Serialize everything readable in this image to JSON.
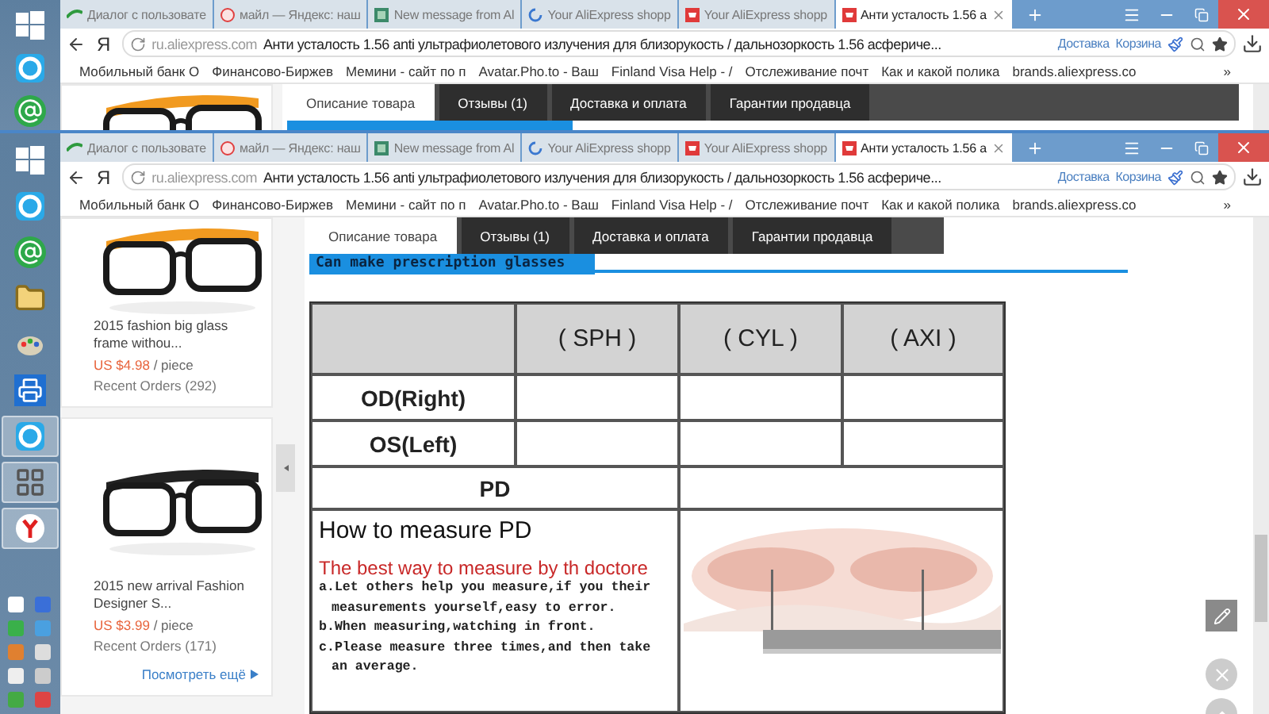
{
  "back_window": {
    "taskbar": [
      {
        "kind": "windows",
        "active": false
      },
      {
        "kind": "skype",
        "active": false
      },
      {
        "kind": "mail",
        "active": false
      }
    ],
    "tabs": [
      {
        "title": "Диалог с пользовате",
        "kind": "dialog",
        "selected": false
      },
      {
        "title": "майл — Яндекс: наш",
        "kind": "yandex",
        "selected": false
      },
      {
        "title": "New message from Al",
        "kind": "message",
        "selected": false
      },
      {
        "title": "Your AliExpress shopp",
        "kind": "loading",
        "selected": false
      },
      {
        "title": "Your AliExpress shopp",
        "kind": "shop",
        "selected": false
      },
      {
        "title": "Анти усталость 1.56 а",
        "kind": "shop",
        "selected": true
      }
    ],
    "address": {
      "logo": "Я",
      "domain": "ru.aliexpress.com",
      "title": "Анти усталость 1.56 anti ультрафиолетового излучения для близорукость / дальнозоркость 1.56 асфериче...",
      "links": [
        "Доставка",
        "Корзина"
      ]
    },
    "bookmarks": {
      "items": [
        "Мобильный банк О",
        "Финансово-Биржев",
        "Мемини - сайт по п",
        "Avatar.Pho.to - Ваш",
        "Finland Visa Help - /",
        "Отслеживание почт",
        "Как и какой полика",
        "brands.aliexpress.co"
      ],
      "overflow": "»"
    },
    "product_tabs": [
      {
        "label": "Описание товара",
        "selected": true
      },
      {
        "label": "Отзывы (1)",
        "selected": false
      },
      {
        "label": "Доставка и оплата",
        "selected": false
      },
      {
        "label": "Гарантии продавца",
        "selected": false
      }
    ]
  },
  "front_window": {
    "taskbar": [
      {
        "kind": "windows",
        "active": false
      },
      {
        "kind": "skype",
        "active": false
      },
      {
        "kind": "mail",
        "active": false
      },
      {
        "kind": "folder",
        "active": false
      },
      {
        "kind": "paint",
        "active": false
      },
      {
        "kind": "scanner",
        "active": false
      },
      {
        "kind": "skype",
        "active": true
      },
      {
        "kind": "app",
        "active": true
      },
      {
        "kind": "yandex",
        "active": true
      }
    ],
    "tabs": [
      {
        "title": "Диалог с пользовате",
        "kind": "dialog",
        "selected": false
      },
      {
        "title": "майл — Яндекс: наш",
        "kind": "yandex",
        "selected": false
      },
      {
        "title": "New message from Al",
        "kind": "message",
        "selected": false
      },
      {
        "title": "Your AliExpress shopp",
        "kind": "loading",
        "selected": false
      },
      {
        "title": "Your AliExpress shopp",
        "kind": "shop",
        "selected": false
      },
      {
        "title": "Анти усталость 1.56 а",
        "kind": "shop",
        "selected": true
      }
    ],
    "address": {
      "logo": "Я",
      "domain": "ru.aliexpress.com",
      "title": "Анти усталость 1.56 anti ультрафиолетового излучения для близорукость / дальнозоркость 1.56 асфериче...",
      "links": [
        "Доставка",
        "Корзина"
      ]
    },
    "bookmarks": {
      "items": [
        "Мобильный банк О",
        "Финансово-Биржев",
        "Мемини - сайт по п",
        "Avatar.Pho.to - Ваш",
        "Finland Visa Help - /",
        "Отслеживание почт",
        "Как и какой полика",
        "brands.aliexpress.co"
      ],
      "overflow": "»"
    },
    "sidebar": {
      "products": [
        {
          "name": "2015 fashion big glass frame withou...",
          "price": "US $4.98",
          "unit": "/ piece",
          "orders": "Recent Orders (292)"
        },
        {
          "name": "2015 new arrival Fashion Designer S...",
          "price": "US $3.99",
          "unit": "/ piece",
          "orders": "Recent Orders (171)"
        }
      ],
      "more_link": "Посмотреть ещё"
    },
    "product_tabs": [
      {
        "label": "Описание товара",
        "selected": true
      },
      {
        "label": "Отзывы (1)",
        "selected": false
      },
      {
        "label": "Доставка и оплата",
        "selected": false
      },
      {
        "label": "Гарантии продавца",
        "selected": false
      }
    ],
    "banner": "Can make prescription glasses",
    "table": {
      "columns": [
        "( SPH )",
        "( CYL )",
        "( AXI )"
      ],
      "rows": [
        "OD(Right)",
        "OS(Left)",
        "PD"
      ]
    },
    "measure": {
      "title": "How to measure PD",
      "subtitle": "The best way to measure by th doctore",
      "steps": [
        "a.Let others help you measure,if you their measurements yourself,easy to error.",
        "b.When measuring,watching in front.",
        "c.Please measure three times,and then take an average."
      ]
    }
  }
}
